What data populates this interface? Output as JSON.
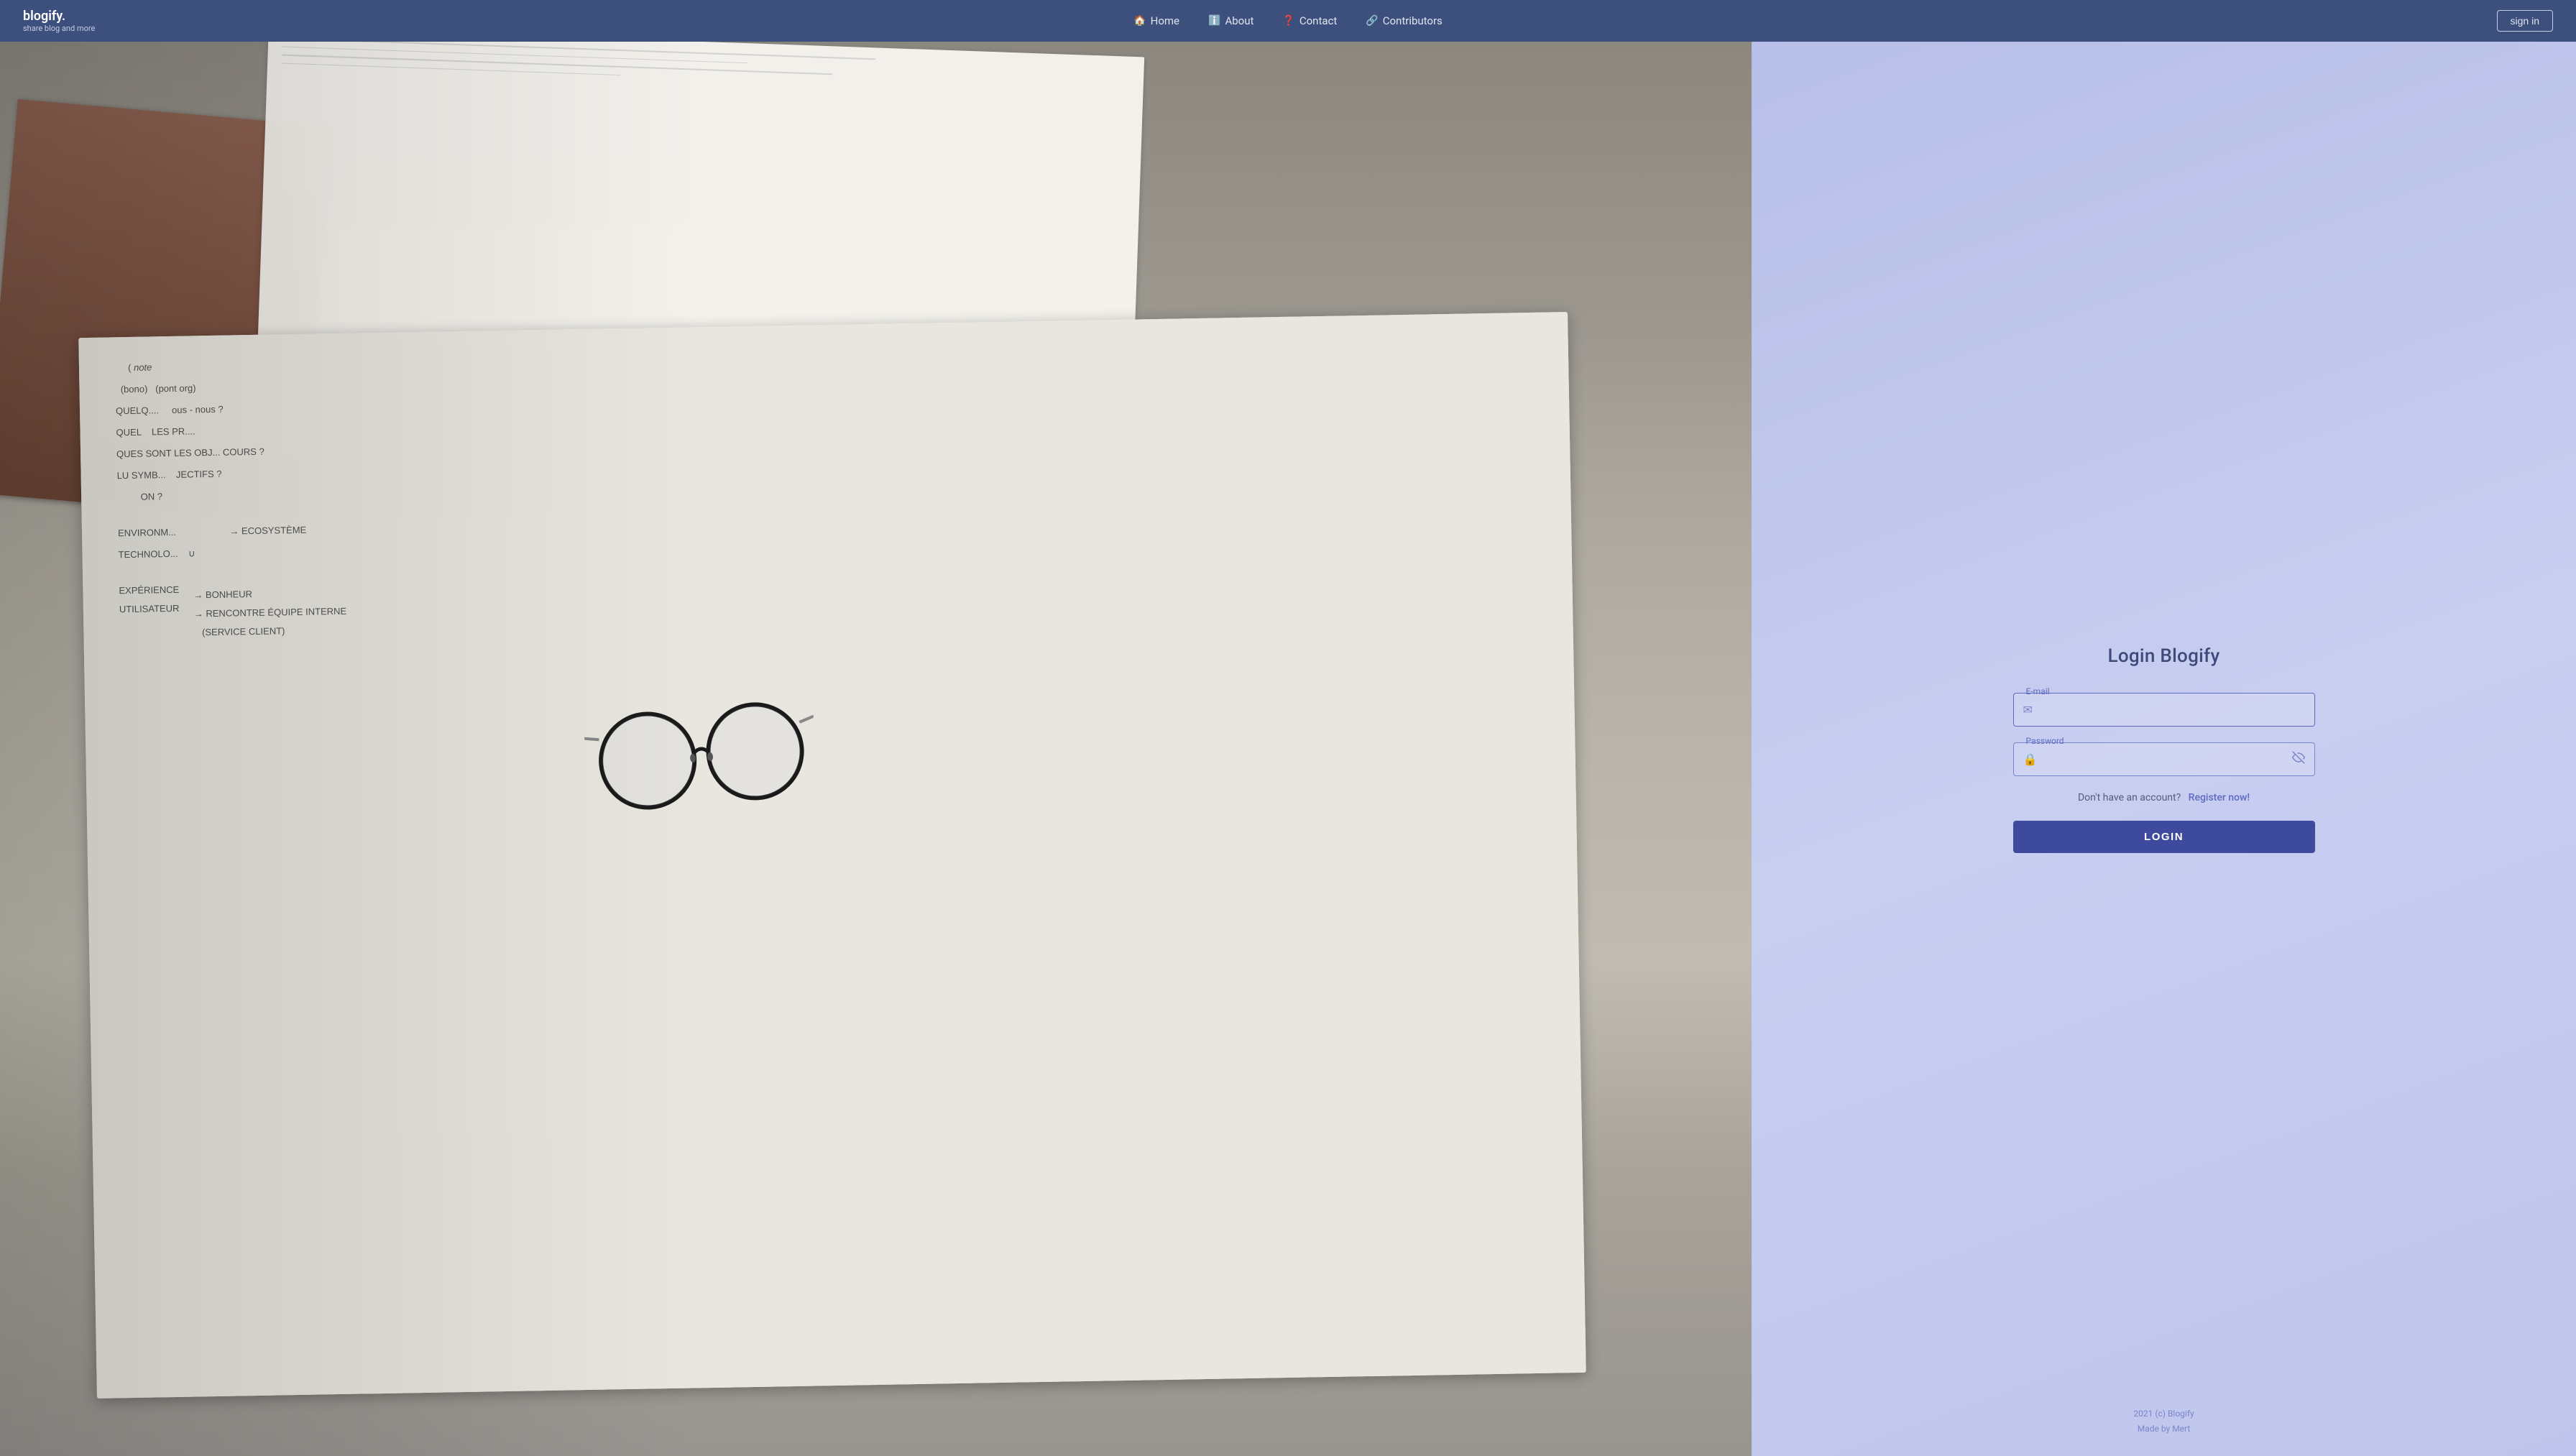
{
  "navbar": {
    "brand": {
      "title": "blogify.",
      "subtitle": "share blog and more"
    },
    "nav_items": [
      {
        "label": "Home",
        "icon": "🏠",
        "id": "home"
      },
      {
        "label": "About",
        "icon": "ℹ️",
        "id": "about"
      },
      {
        "label": "Contact",
        "icon": "❓",
        "id": "contact"
      },
      {
        "label": "Contributors",
        "icon": "🔗",
        "id": "contributors"
      }
    ],
    "sign_in_label": "sign in"
  },
  "login_panel": {
    "title": "Login Blogify",
    "email_label": "E-mail",
    "email_placeholder": "",
    "password_label": "Password",
    "password_placeholder": "",
    "no_account_text": "Don't have an account?",
    "register_link_text": "Register now!",
    "login_button_label": "LOGIN",
    "footer_line1": "2021 (c) Blogify",
    "footer_line2": "Made by Mert"
  },
  "photo": {
    "notebook_texts": [
      "(note",
      "(bono)  (pont org)",
      "QUELQ... ous - NOUS?",
      "QUEL    LES PR...",
      "QUES  SONT LES OBJ... COURS?",
      "LU SYMB...    JECTIFS?",
      "         ON?",
      "",
      "ENVIRONM...",
      "TECHNOLO...",
      "",
      "EXPÉRIENCE      BONHEUR",
      "UTILISATEUR  → RENCONTRE ÉQUIPE INTERNE",
      "             (SERVICE CLIENT)"
    ]
  }
}
